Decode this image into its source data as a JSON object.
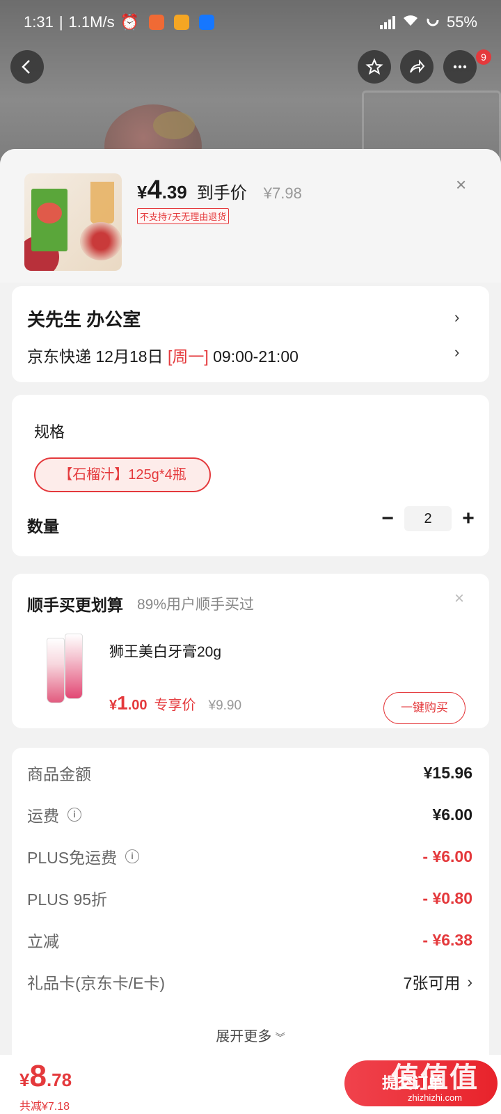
{
  "status_bar": {
    "time": "1:31",
    "net_speed": "1.1M/s",
    "battery": "55%"
  },
  "nav": {
    "back_label": "‹",
    "badge_count": "9"
  },
  "product": {
    "price_symbol": "¥",
    "price_int": "4",
    "price_dec": ".39",
    "price_label": "到手价",
    "original_price": "¥7.98",
    "return_policy": "不支持7天无理由退货",
    "close_symbol": "×"
  },
  "address": {
    "name_line": "关先生  办公室",
    "courier": "京东快递",
    "date": "12月18日",
    "weekday": "[周一]",
    "time_window": "09:00-21:00"
  },
  "spec": {
    "title": "规格",
    "selected_option": "【石榴汁】125g*4瓶",
    "quantity_label": "数量",
    "quantity": "2",
    "minus": "−",
    "plus": "+"
  },
  "addon": {
    "title": "顺手买更划算",
    "subtitle": "89%用户顺手买过",
    "close_symbol": "×",
    "product_name": "狮王美白牙膏20g",
    "price_symbol": "¥",
    "price_int": "1",
    "price_dec": ".00",
    "price_label": "专享价",
    "original_price": "¥9.90",
    "buy_button": "一键购买"
  },
  "summary": {
    "rows": [
      {
        "label": "商品金额",
        "value": "¥15.96"
      },
      {
        "label": "运费",
        "value": "¥6.00"
      },
      {
        "label": "PLUS免运费",
        "value": "- ¥6.00"
      },
      {
        "label": "PLUS 95折",
        "value": "- ¥0.80"
      },
      {
        "label": "立减",
        "value": "- ¥6.38"
      },
      {
        "label": "礼品卡(京东卡/E卡)",
        "value": "7张可用"
      }
    ],
    "expand_more": "展开更多"
  },
  "bottom": {
    "total_symbol": "¥",
    "total_int": "8",
    "total_dec": ".78",
    "total_saved": "共减¥7.18",
    "submit_button": "提交订单"
  },
  "watermark": {
    "big": "值值值",
    "small": "zhizhizhi.com"
  },
  "colors": {
    "accent": "#e4393c"
  }
}
